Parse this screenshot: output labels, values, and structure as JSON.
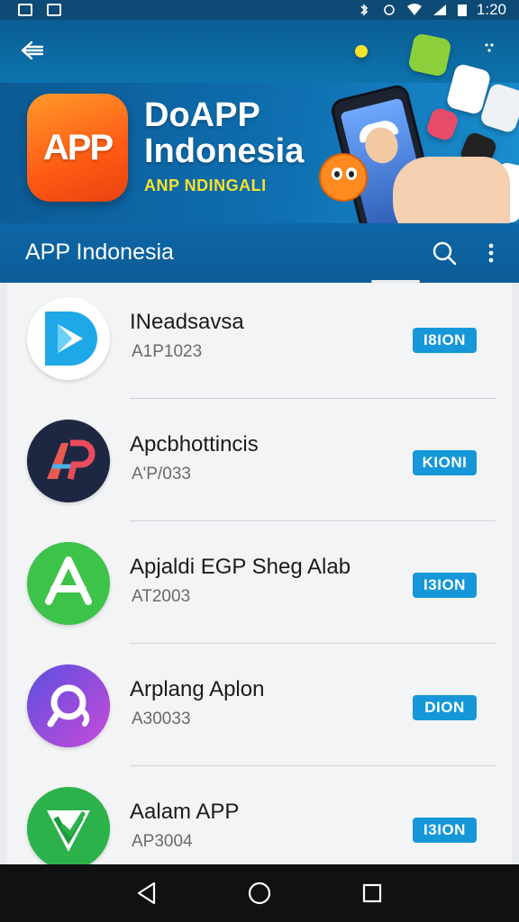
{
  "status_bar": {
    "time": "1:20",
    "icons": [
      "image-icon",
      "document-icon",
      "bluetooth-icon",
      "alarm-icon",
      "wifi-icon",
      "signal-icon",
      "battery-icon"
    ]
  },
  "banner": {
    "logo_text": "APP",
    "title_line1": "DoAPP",
    "title_line2": "Indonesia",
    "subtitle": "ANP NDINGALI",
    "icons": [
      "back-arrow-icon",
      "more-dots-icon",
      "mascot-icon",
      "phone-icon",
      "hand-icon"
    ]
  },
  "appbar": {
    "title": "APP Indonesia",
    "icons": [
      "search-icon",
      "more-vert-icon"
    ]
  },
  "apps": [
    {
      "name": "INeadsavsa",
      "code": "A1P1023",
      "button": "I8ION",
      "icon": "play-d-icon"
    },
    {
      "name": "Apcbhottincis",
      "code": "A'P/033",
      "button": "KIONI",
      "icon": "ap-icon"
    },
    {
      "name": "Apjaldi EGP Sheg Alab",
      "code": "AT2003",
      "button": "I3ION",
      "icon": "app-store-icon"
    },
    {
      "name": "Arplang Aplon",
      "code": "A30033",
      "button": "DION",
      "icon": "chat-bubble-icon"
    },
    {
      "name": "Aalam APP",
      "code": "AP3004",
      "button": "I3ION",
      "icon": "shield-check-icon"
    }
  ],
  "navbar": {
    "icons": [
      "back-triangle-icon",
      "home-circle-icon",
      "recents-square-icon"
    ]
  },
  "colors": {
    "primary": "#0b5c97",
    "install": "#1597d9",
    "accent": "#f7e32b",
    "logo": "#ff5a14"
  }
}
